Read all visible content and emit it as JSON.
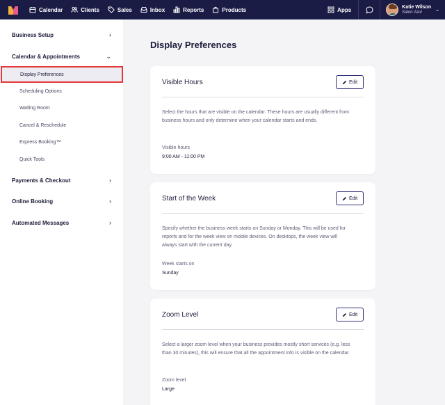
{
  "nav": {
    "items": [
      {
        "label": "Calendar",
        "icon": "calendar-icon"
      },
      {
        "label": "Clients",
        "icon": "clients-icon"
      },
      {
        "label": "Sales",
        "icon": "tag-icon"
      },
      {
        "label": "Inbox",
        "icon": "inbox-icon"
      },
      {
        "label": "Reports",
        "icon": "bar-chart-icon"
      },
      {
        "label": "Products",
        "icon": "bag-icon"
      }
    ],
    "apps_label": "Apps",
    "user_name": "Katie Wilson",
    "user_salon": "Salon Azul"
  },
  "sidebar": {
    "sections": [
      {
        "label": "Business Setup",
        "chevron": "›"
      },
      {
        "label": "Calendar & Appointments",
        "chevron": "⌄"
      },
      {
        "label": "Payments & Checkout",
        "chevron": "›"
      },
      {
        "label": "Online Booking",
        "chevron": "›"
      },
      {
        "label": "Automated Messages",
        "chevron": "›"
      }
    ],
    "sub_items": [
      {
        "label": "Display Preferences",
        "active": true
      },
      {
        "label": "Scheduling Options"
      },
      {
        "label": "Waiting Room"
      },
      {
        "label": "Cancel & Reschedule"
      },
      {
        "label": "Express Booking™"
      },
      {
        "label": "Quick Tools"
      }
    ]
  },
  "main": {
    "title": "Display Preferences",
    "edit_label": "Edit",
    "cards": [
      {
        "title": "Visible Hours",
        "description": "Select the hours that are visible on the calendar. These hours are usually different from business hours and only determine when your calendar starts and ends.",
        "field_label": "Visible hours",
        "field_value": "9:00 AM - 11:00 PM"
      },
      {
        "title": "Start of the Week",
        "description": "Specify whether the business week starts on Sunday or Monday. This will be used for reports and for the week view on mobile devices. On desktops, the week view will always start with the current day.",
        "field_label": "Week starts on",
        "field_value": "Sunday"
      },
      {
        "title": "Zoom Level",
        "description": "Select a larger zoom level when your business provides mostly short services (e.g. less than 30 minutes), this will ensure that all the appointment info is visible on the calendar.",
        "field_label": "Zoom level",
        "field_value": "Large"
      }
    ]
  },
  "colors": {
    "nav_bg": "#1b1c46",
    "page_bg": "#f4f4f7",
    "active_outline": "#e4393a",
    "button_border": "#2f3077"
  }
}
